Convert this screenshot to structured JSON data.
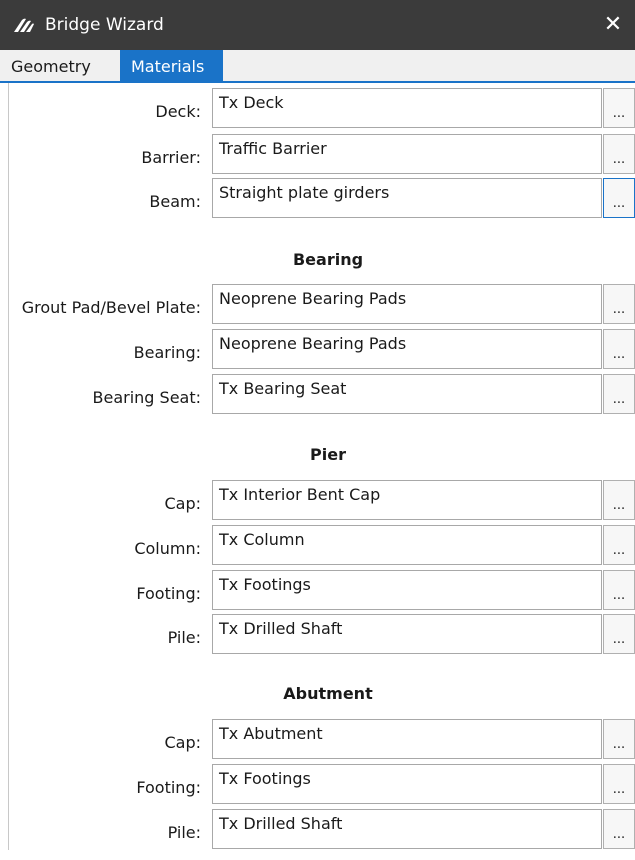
{
  "window": {
    "title": "Bridge Wizard",
    "close_glyph": "✕"
  },
  "tabs": [
    {
      "label": "Geometry",
      "selected": false
    },
    {
      "label": "Materials",
      "selected": true
    }
  ],
  "browse_label": "...",
  "main": {
    "deck": {
      "label": "Deck:",
      "value": "Tx Deck"
    },
    "barrier": {
      "label": "Barrier:",
      "value": "Traffic Barrier"
    },
    "beam": {
      "label": "Beam:",
      "value": "Straight plate girders"
    }
  },
  "bearing": {
    "title": "Bearing",
    "grout_pad": {
      "label": "Grout Pad/Bevel Plate:",
      "value": "Neoprene Bearing Pads"
    },
    "bearing": {
      "label": "Bearing:",
      "value": "Neoprene Bearing Pads"
    },
    "seat": {
      "label": "Bearing Seat:",
      "value": "Tx Bearing Seat"
    }
  },
  "pier": {
    "title": "Pier",
    "cap": {
      "label": "Cap:",
      "value": "Tx Interior Bent Cap"
    },
    "column": {
      "label": "Column:",
      "value": "Tx Column"
    },
    "footing": {
      "label": "Footing:",
      "value": "Tx Footings"
    },
    "pile": {
      "label": "Pile:",
      "value": "Tx Drilled Shaft"
    }
  },
  "abutment": {
    "title": "Abutment",
    "cap": {
      "label": "Cap:",
      "value": "Tx Abutment"
    },
    "footing": {
      "label": "Footing:",
      "value": "Tx Footings"
    },
    "pile": {
      "label": "Pile:",
      "value": "Tx Drilled Shaft"
    }
  },
  "colors": {
    "accent": "#1a73c8",
    "titlebar": "#3b3b3b"
  }
}
